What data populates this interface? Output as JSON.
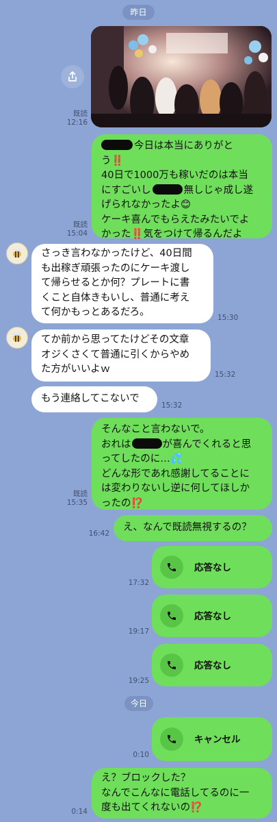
{
  "dates": {
    "yesterday": "昨日",
    "today": "今日"
  },
  "photo_message": {
    "read": "既読",
    "time": "12:16"
  },
  "messages": [
    {
      "read": "既読",
      "time": "15:04",
      "lines": [
        "今日は本当にありがと",
        "う‼️",
        "40日で1000万も稼いだのは本当",
        "にすごいし",
        "無しじゃ成し遂",
        "げられなかったよ😊",
        "ケーキ喜んでもらえたみたいでよ",
        "かった‼️気をつけて帰るんだよ"
      ]
    },
    {
      "time": "15:30",
      "lines": [
        "さっき言わなかったけど、40日間",
        "も出稼ぎ頑張ったのにケーキ渡し",
        "て帰らせるとか何？プレートに書",
        "くこと自体きもいし、普通に考え",
        "て何かもっとあるだろ。"
      ]
    },
    {
      "time": "15:32",
      "lines": [
        "てか前から思ってたけどその文章",
        "オジくさくて普通に引くからやめ",
        "た方がいいよｗ"
      ]
    },
    {
      "time": "15:32",
      "lines": [
        "もう連絡してこないで"
      ]
    },
    {
      "read": "既読",
      "time": "15:35",
      "lines": [
        "そんなこと言わないで。",
        "おれは",
        "が喜んでくれると思",
        "ってしたのに…💦",
        "どんな形であれ感謝してることに",
        "は変わりないし逆に何してほしか",
        "ったの⁉️"
      ]
    },
    {
      "time": "16:42",
      "lines": [
        "え、なんで既読無視するの？"
      ]
    },
    {
      "time": "0:14",
      "lines": [
        "え？ブロックした？",
        "なんでこんなに電話してるのに一",
        "度も出てくれないの⁉️"
      ]
    }
  ],
  "calls": [
    {
      "label": "応答なし",
      "time": "17:32"
    },
    {
      "label": "応答なし",
      "time": "19:17"
    },
    {
      "label": "応答なし",
      "time": "19:25"
    },
    {
      "label": "キャンセル",
      "time": "0:10"
    }
  ],
  "colors": {
    "background": "#8da5d4",
    "sent": "#6fde5b",
    "received": "#ffffff"
  }
}
